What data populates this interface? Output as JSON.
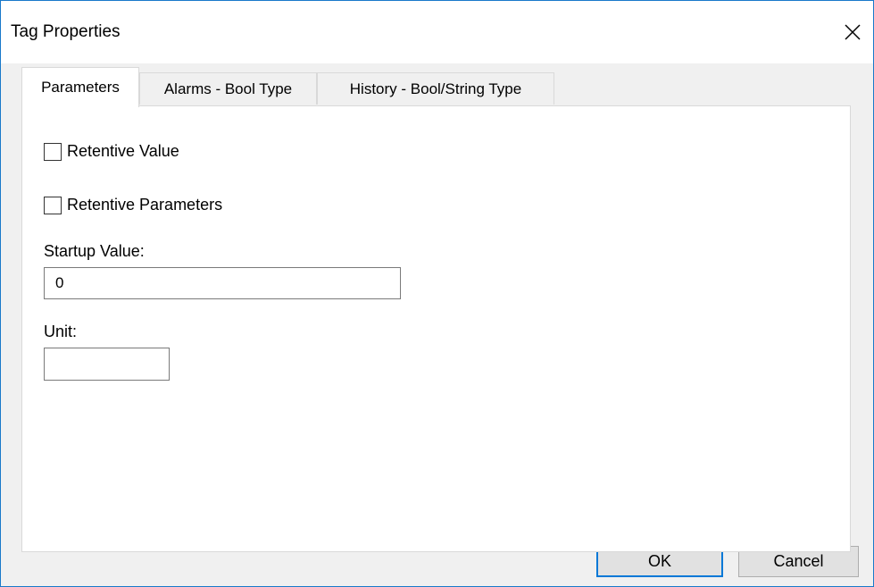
{
  "window": {
    "title": "Tag Properties",
    "close_icon": "close-icon"
  },
  "tabs": [
    {
      "label": "Parameters",
      "active": true
    },
    {
      "label": "Alarms - Bool Type",
      "active": false
    },
    {
      "label": "History - Bool/String Type",
      "active": false
    }
  ],
  "parameters": {
    "retentive_value": {
      "label": "Retentive Value",
      "checked": false
    },
    "retentive_parameters": {
      "label": "Retentive Parameters",
      "checked": false
    },
    "startup_value": {
      "label": "Startup Value:",
      "value": "0"
    },
    "unit": {
      "label": "Unit:",
      "value": ""
    }
  },
  "buttons": {
    "ok": "OK",
    "cancel": "Cancel"
  },
  "colors": {
    "window_border": "#1979ca",
    "default_button_border": "#0078d7",
    "dialog_background": "#f0f0f0"
  }
}
